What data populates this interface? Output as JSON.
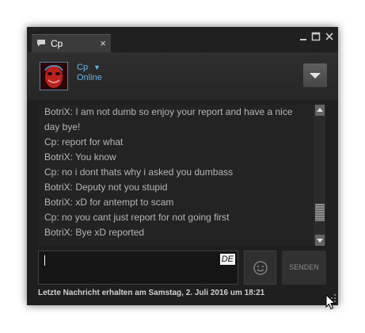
{
  "window": {
    "tab": {
      "title": "Cp",
      "icon": "chat-bubble-icon",
      "close_glyph": "×"
    },
    "controls": [
      "minimize-icon",
      "maximize-icon",
      "close-icon"
    ]
  },
  "friend": {
    "name": "Cp",
    "status": "Online",
    "caret": "▼"
  },
  "messages": [
    "BotriX: I am not dumb so enjoy your report and have a nice day bye!",
    "Cp: report for what",
    "BotriX: You know",
    "Cp: no i dont thats why i asked you dumbass",
    "BotriX: Deputy not you stupid",
    "BotriX: xD for antempt to scam",
    "Cp: no you cant just report for not going first",
    "BotriX: Bye xD reported"
  ],
  "input": {
    "value": "",
    "language_badge": "DE"
  },
  "buttons": {
    "emoji_icon": "smiley-icon",
    "send_label": "SENDEN"
  },
  "footer": {
    "last_message": "Letzte Nachricht erhalten am Samstag, 2. Juli 2016 um 18:21"
  },
  "colors": {
    "window_bg": "#1f1f1f",
    "tab_bg": "#3b3b3b",
    "accent": "#63b5e8",
    "message_text": "#b5b5b5"
  }
}
